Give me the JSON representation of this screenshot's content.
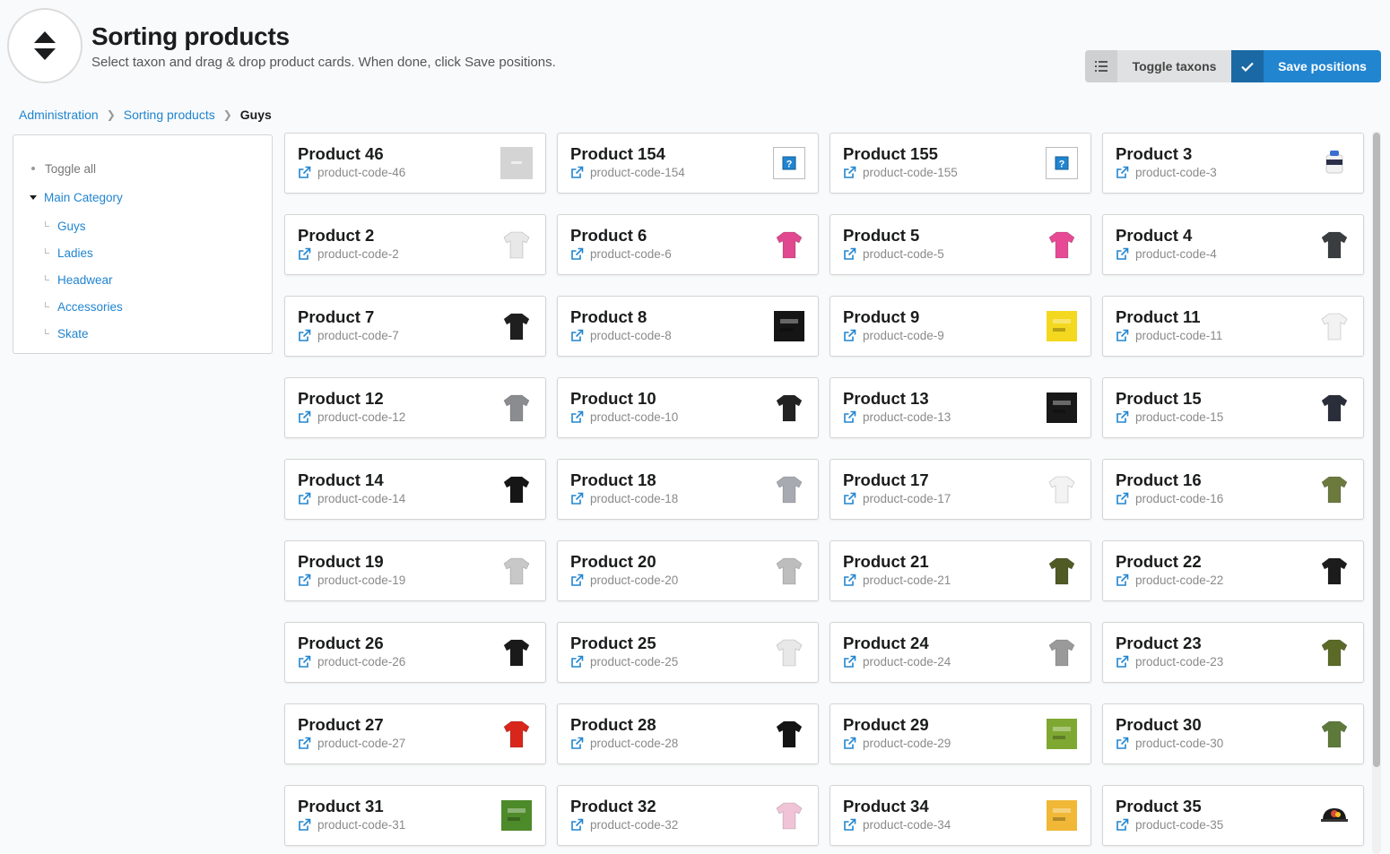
{
  "header": {
    "title": "Sorting products",
    "subtitle": "Select taxon and drag & drop product cards. When done, click Save positions.",
    "icon": "sort-icon"
  },
  "toolbar": {
    "toggle_label": "Toggle taxons",
    "save_label": "Save positions"
  },
  "breadcrumb": {
    "items": [
      "Administration",
      "Sorting products"
    ],
    "active": "Guys"
  },
  "sidebar": {
    "toggle_all": "Toggle all",
    "main_category": "Main Category",
    "children": [
      "Guys",
      "Ladies",
      "Headwear",
      "Accessories",
      "Skate"
    ]
  },
  "colors": {
    "primary": "#2185d0",
    "link": "#2185d0"
  },
  "products": [
    {
      "name": "Product 46",
      "code": "product-code-46",
      "thumb": "placeholder"
    },
    {
      "name": "Product 154",
      "code": "product-code-154",
      "thumb": "unknown"
    },
    {
      "name": "Product 155",
      "code": "product-code-155",
      "thumb": "unknown"
    },
    {
      "name": "Product 3",
      "code": "product-code-3",
      "thumb": "mug"
    },
    {
      "name": "Product 2",
      "code": "product-code-2",
      "thumb": "shirt",
      "color": "#e8e8e8"
    },
    {
      "name": "Product 6",
      "code": "product-code-6",
      "thumb": "shirt",
      "color": "#e0488f"
    },
    {
      "name": "Product 5",
      "code": "product-code-5",
      "thumb": "shirt",
      "color": "#e64a95"
    },
    {
      "name": "Product 4",
      "code": "product-code-4",
      "thumb": "shirt",
      "color": "#3a3d40"
    },
    {
      "name": "Product 7",
      "code": "product-code-7",
      "thumb": "shirt",
      "color": "#1f1f1f"
    },
    {
      "name": "Product 8",
      "code": "product-code-8",
      "thumb": "square",
      "color": "#151515"
    },
    {
      "name": "Product 9",
      "code": "product-code-9",
      "thumb": "square",
      "color": "#f4d81f"
    },
    {
      "name": "Product 11",
      "code": "product-code-11",
      "thumb": "shirt",
      "color": "#f2f2f2"
    },
    {
      "name": "Product 12",
      "code": "product-code-12",
      "thumb": "shirt",
      "color": "#8a8c90"
    },
    {
      "name": "Product 10",
      "code": "product-code-10",
      "thumb": "shirt",
      "color": "#222222"
    },
    {
      "name": "Product 13",
      "code": "product-code-13",
      "thumb": "square",
      "color": "#181818"
    },
    {
      "name": "Product 15",
      "code": "product-code-15",
      "thumb": "shirt",
      "color": "#2a2e3a"
    },
    {
      "name": "Product 14",
      "code": "product-code-14",
      "thumb": "shirt",
      "color": "#161616"
    },
    {
      "name": "Product 18",
      "code": "product-code-18",
      "thumb": "shirt",
      "color": "#a8aab2"
    },
    {
      "name": "Product 17",
      "code": "product-code-17",
      "thumb": "shirt",
      "color": "#f3f3f3"
    },
    {
      "name": "Product 16",
      "code": "product-code-16",
      "thumb": "shirt",
      "color": "#6d7a3e"
    },
    {
      "name": "Product 19",
      "code": "product-code-19",
      "thumb": "shirt",
      "color": "#c8c8c8"
    },
    {
      "name": "Product 20",
      "code": "product-code-20",
      "thumb": "shirt",
      "color": "#bdbdbd"
    },
    {
      "name": "Product 21",
      "code": "product-code-21",
      "thumb": "shirt",
      "color": "#4f5a25"
    },
    {
      "name": "Product 22",
      "code": "product-code-22",
      "thumb": "shirt",
      "color": "#1c1c1c"
    },
    {
      "name": "Product 26",
      "code": "product-code-26",
      "thumb": "shirt",
      "color": "#1a1a1a"
    },
    {
      "name": "Product 25",
      "code": "product-code-25",
      "thumb": "shirt",
      "color": "#e8e8e8"
    },
    {
      "name": "Product 24",
      "code": "product-code-24",
      "thumb": "shirt",
      "color": "#9a9a9a"
    },
    {
      "name": "Product 23",
      "code": "product-code-23",
      "thumb": "shirt",
      "color": "#5b6a26"
    },
    {
      "name": "Product 27",
      "code": "product-code-27",
      "thumb": "shirt",
      "color": "#d9261c"
    },
    {
      "name": "Product 28",
      "code": "product-code-28",
      "thumb": "shirt",
      "color": "#141414"
    },
    {
      "name": "Product 29",
      "code": "product-code-29",
      "thumb": "square",
      "color": "#7fa832"
    },
    {
      "name": "Product 30",
      "code": "product-code-30",
      "thumb": "shirt",
      "color": "#5d7a3a"
    },
    {
      "name": "Product 31",
      "code": "product-code-31",
      "thumb": "square",
      "color": "#4d8a2a"
    },
    {
      "name": "Product 32",
      "code": "product-code-32",
      "thumb": "shirt",
      "color": "#f1c3d6"
    },
    {
      "name": "Product 34",
      "code": "product-code-34",
      "thumb": "square",
      "color": "#f0b836"
    },
    {
      "name": "Product 35",
      "code": "product-code-35",
      "thumb": "cap",
      "color": "#1a1a1a"
    }
  ]
}
